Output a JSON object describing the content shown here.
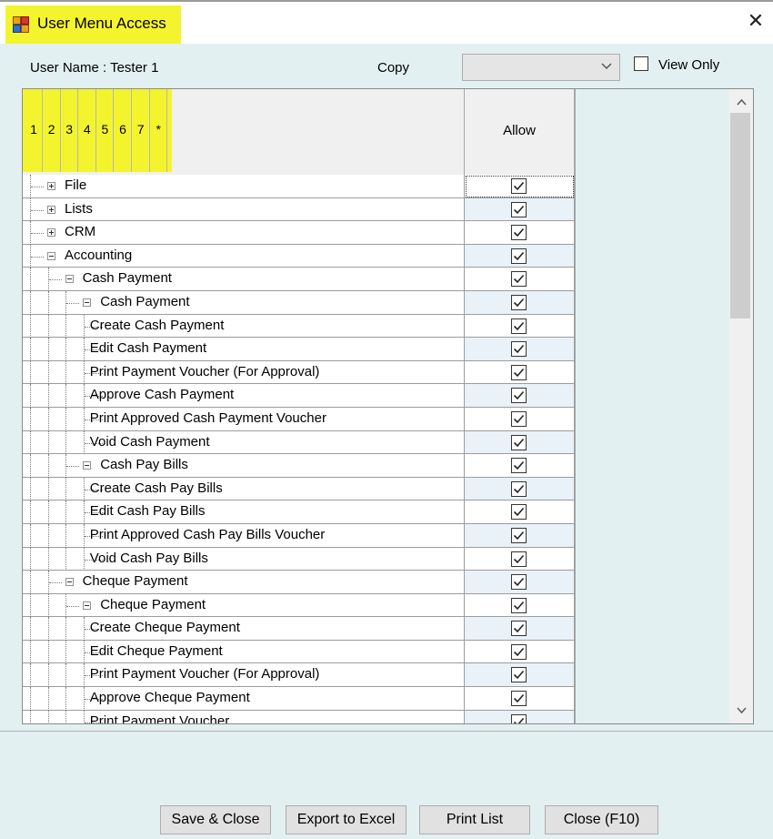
{
  "window": {
    "title": "User Menu Access",
    "close_glyph": "✕",
    "icon": "app-window-icon",
    "highlight_color": "#f4f42e"
  },
  "form": {
    "user_name_label": "User Name : Tester 1",
    "copy_label": "Copy",
    "copy_value": "",
    "view_only_label": "View Only",
    "view_only_checked": false
  },
  "grid": {
    "level_headers": [
      "1",
      "2",
      "3",
      "4",
      "5",
      "6",
      "7",
      "*"
    ],
    "allow_header": "Allow",
    "rows": [
      {
        "label": "File",
        "depth": 0,
        "expander": "plus",
        "checked": true
      },
      {
        "label": "Lists",
        "depth": 0,
        "expander": "plus",
        "checked": true
      },
      {
        "label": "CRM",
        "depth": 0,
        "expander": "plus",
        "checked": true
      },
      {
        "label": "Accounting",
        "depth": 0,
        "expander": "minus",
        "checked": true
      },
      {
        "label": "Cash Payment",
        "depth": 1,
        "expander": "minus",
        "checked": true
      },
      {
        "label": "Cash Payment",
        "depth": 2,
        "expander": "minus",
        "checked": true
      },
      {
        "label": "Create Cash Payment",
        "depth": 3,
        "expander": "none",
        "checked": true
      },
      {
        "label": "Edit Cash Payment",
        "depth": 3,
        "expander": "none",
        "checked": true
      },
      {
        "label": "Print Payment Voucher (For Approval)",
        "depth": 3,
        "expander": "none",
        "checked": true
      },
      {
        "label": "Approve Cash Payment",
        "depth": 3,
        "expander": "none",
        "checked": true
      },
      {
        "label": "Print Approved Cash Payment Voucher",
        "depth": 3,
        "expander": "none",
        "checked": true
      },
      {
        "label": "Void Cash Payment",
        "depth": 3,
        "expander": "none",
        "checked": true
      },
      {
        "label": "Cash Pay Bills",
        "depth": 2,
        "expander": "minus",
        "checked": true
      },
      {
        "label": "Create Cash Pay Bills",
        "depth": 3,
        "expander": "none",
        "checked": true
      },
      {
        "label": "Edit Cash  Pay Bills",
        "depth": 3,
        "expander": "none",
        "checked": true
      },
      {
        "label": "Print Approved Cash Pay Bills Voucher",
        "depth": 3,
        "expander": "none",
        "checked": true
      },
      {
        "label": "Void Cash Pay Bills",
        "depth": 3,
        "expander": "none",
        "checked": true
      },
      {
        "label": "Cheque Payment",
        "depth": 1,
        "expander": "minus",
        "checked": true
      },
      {
        "label": "Cheque Payment",
        "depth": 2,
        "expander": "minus",
        "checked": true
      },
      {
        "label": "Create Cheque Payment",
        "depth": 3,
        "expander": "none",
        "checked": true
      },
      {
        "label": "Edit Cheque Payment",
        "depth": 3,
        "expander": "none",
        "checked": true
      },
      {
        "label": "Print Payment Voucher (For Approval)",
        "depth": 3,
        "expander": "none",
        "checked": true
      },
      {
        "label": "Approve Cheque Payment",
        "depth": 3,
        "expander": "none",
        "checked": true
      },
      {
        "label": "Print  Payment Voucher",
        "depth": 3,
        "expander": "none",
        "checked": true
      }
    ]
  },
  "buttons": {
    "save_close": "Save & Close",
    "export_excel": "Export to Excel",
    "print_list": "Print List",
    "close": "Close (F10)"
  }
}
